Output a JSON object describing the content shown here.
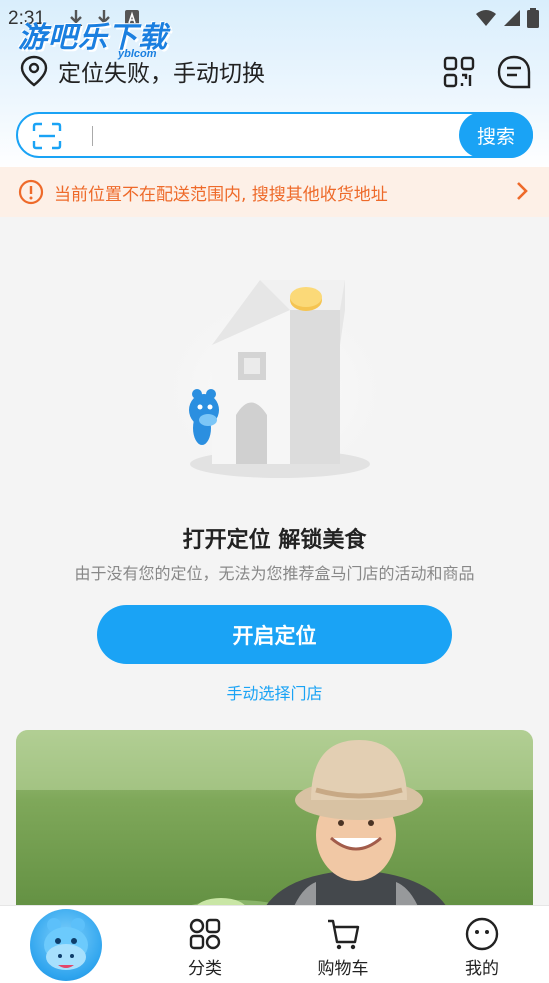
{
  "status_bar": {
    "time": "2:31"
  },
  "watermark": {
    "main": "游吧乐下载",
    "sub": "yblcom"
  },
  "header": {
    "location_text": "定位失败，手动切换"
  },
  "search": {
    "placeholder": "",
    "button_label": "搜索"
  },
  "notice": {
    "text": "当前位置不在配送范围内, 搜搜其他收货地址"
  },
  "empty_state": {
    "title": "打开定位 解锁美食",
    "subtitle": "由于没有您的定位，无法为您推荐盒马门店的活动和商品",
    "primary_button": "开启定位",
    "secondary_link": "手动选择门店"
  },
  "tabbar": {
    "items": [
      {
        "label": "",
        "icon": "hippo-mascot-icon"
      },
      {
        "label": "分类",
        "icon": "category-grid-icon"
      },
      {
        "label": "购物车",
        "icon": "cart-icon"
      },
      {
        "label": "我的",
        "icon": "profile-smile-icon"
      }
    ]
  },
  "colors": {
    "accent": "#1aa3f5",
    "notice_text": "#ee6a2a",
    "notice_bg": "#fdf0e7"
  }
}
